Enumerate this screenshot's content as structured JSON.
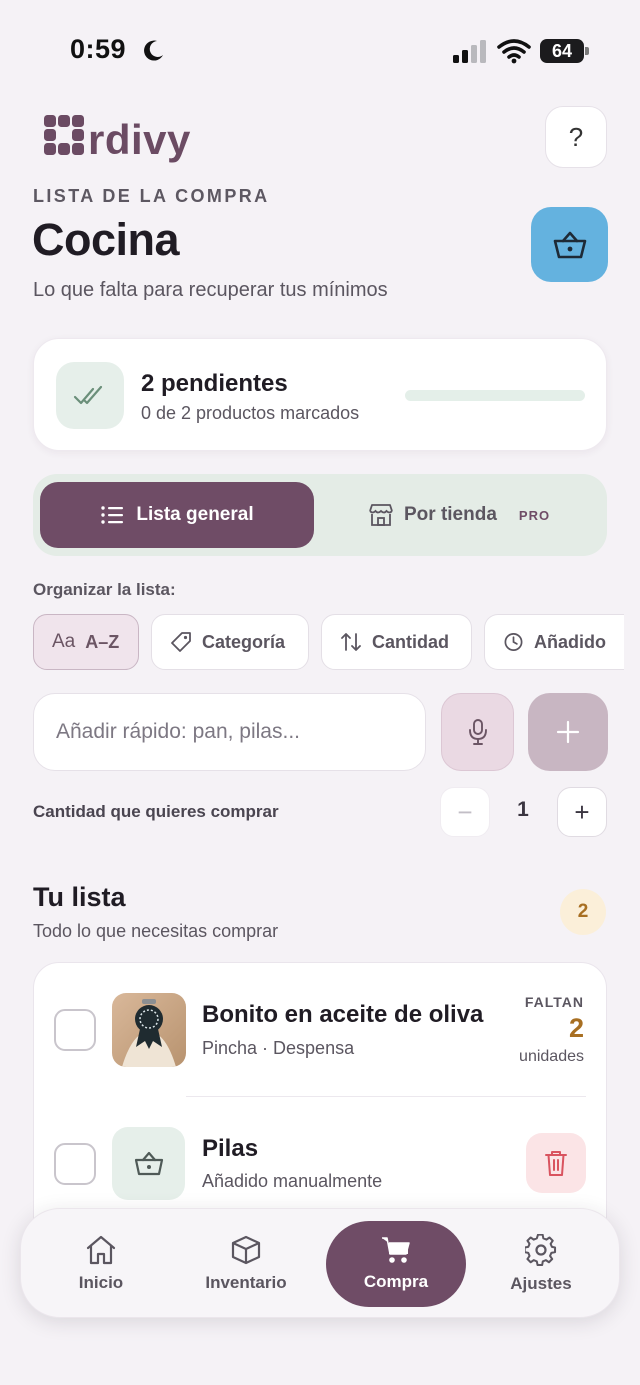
{
  "status": {
    "time": "0:59",
    "battery": "64"
  },
  "brand": {
    "logo_text": "rdivy",
    "logo_color": "#6b4b63"
  },
  "header": {
    "help_label": "?",
    "section_label": "LISTA DE LA COMPRA",
    "title": "Cocina",
    "subtitle": "Lo que falta para recuperar tus mínimos",
    "basket_color": "#64b2df"
  },
  "summary": {
    "title": "2 pendientes",
    "subtitle": "0 de 2 productos marcados",
    "progress": 0
  },
  "view_toggle": {
    "active": {
      "label": "Lista general",
      "icon": "list-icon"
    },
    "inactive": {
      "label": "Por tienda",
      "icon": "store-icon",
      "badge": "PRO"
    }
  },
  "organize": {
    "label": "Organizar la lista:",
    "chips": [
      {
        "prefix": "Aa",
        "label": "A–Z",
        "active": true
      },
      {
        "label": "Categoría",
        "icon": "tag-icon"
      },
      {
        "label": "Cantidad",
        "icon": "sort-icon"
      },
      {
        "label": "Añadido",
        "icon": "clock-icon"
      }
    ]
  },
  "quick_add": {
    "placeholder": "Añadir rápido: pan, pilas...",
    "mic_icon": "microphone-icon",
    "add_icon": "plus-icon"
  },
  "quantity": {
    "label": "Cantidad que quieres comprar",
    "minus": "−",
    "value": "1",
    "plus": "+"
  },
  "list": {
    "title": "Tu lista",
    "subtitle": "Todo lo que necesitas comprar",
    "count": "2",
    "items": [
      {
        "name": "Bonito en aceite de oliva",
        "meta": "Pincha · Despensa",
        "need_label": "FALTAN",
        "need_count": "2",
        "need_unit": "unidades"
      },
      {
        "name": "Pilas",
        "meta": "Añadido manualmente",
        "action_icon": "trash-icon"
      }
    ]
  },
  "tabbar": {
    "tabs": [
      {
        "label": "Inicio",
        "icon": "home-icon"
      },
      {
        "label": "Inventario",
        "icon": "box-icon"
      },
      {
        "label": "Compra",
        "icon": "cart-icon",
        "active": true
      },
      {
        "label": "Ajustes",
        "icon": "gear-icon"
      }
    ],
    "active_color": "#6f4c66"
  }
}
